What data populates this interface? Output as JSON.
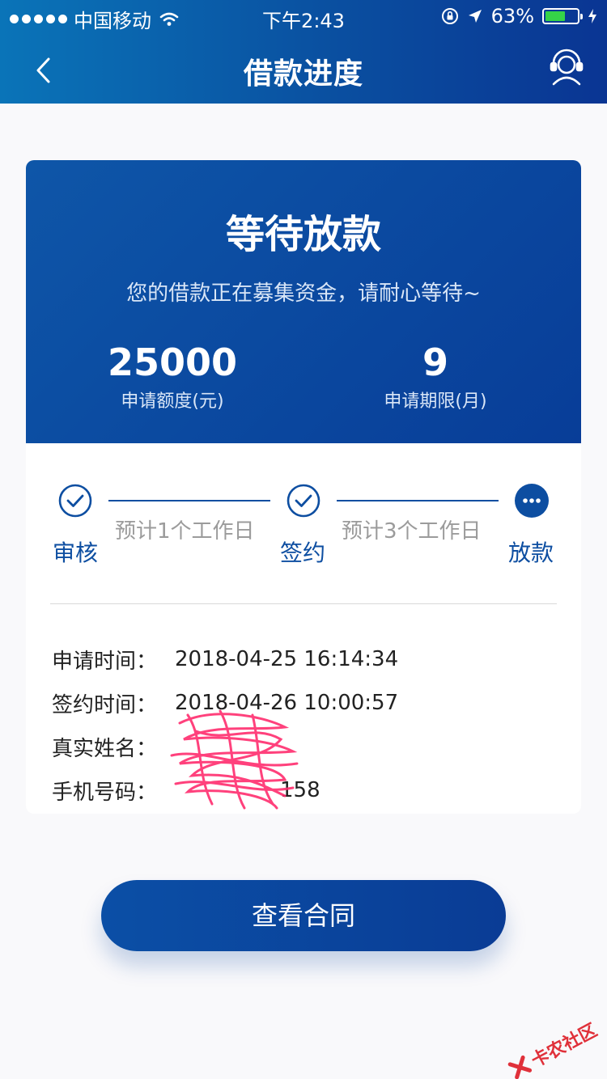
{
  "status_bar": {
    "carrier": "中国移动",
    "time": "下午2:43",
    "battery": "63%",
    "battery_level": 0.63,
    "battery_color": "#35d348"
  },
  "nav": {
    "title": "借款进度",
    "back_icon": "chevron-left-icon",
    "service_icon": "customer-service-icon"
  },
  "summary": {
    "status_title": "等待放款",
    "status_desc": "您的借款正在募集资金，请耐心等待~",
    "amount": "25000",
    "amount_label": "申请额度(元)",
    "term": "9",
    "term_label": "申请期限(月)"
  },
  "steps": [
    {
      "label": "审核",
      "state": "done",
      "icon": "check-circle-icon"
    },
    {
      "label": "签约",
      "state": "done",
      "icon": "check-circle-icon"
    },
    {
      "label": "放款",
      "state": "current",
      "icon": "more-dots-icon"
    }
  ],
  "step_hints": [
    "预计1个工作日",
    "预计3个工作日"
  ],
  "info": [
    {
      "label": "申请时间：",
      "value": "2018-04-25 16:14:34"
    },
    {
      "label": "签约时间：",
      "value": "2018-04-26 10:00:57"
    },
    {
      "label": "真实姓名：",
      "value": ""
    },
    {
      "label": "手机号码：",
      "value": "158"
    }
  ],
  "button": {
    "label": "查看合同"
  },
  "watermark": {
    "text": "卡农社区"
  },
  "colors": {
    "primary": "#0d4ea1",
    "hint": "#9b9b9b",
    "scribble": "#ff2d6e",
    "watermark": "#e0313a"
  }
}
